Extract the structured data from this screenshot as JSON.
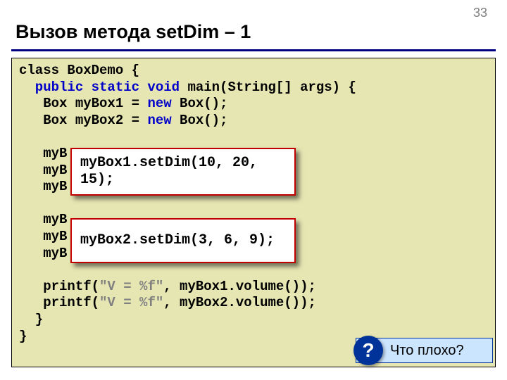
{
  "page_number": "33",
  "title": "Вызов метода setDim – 1",
  "code": {
    "l1a": "class",
    "l1b": " BoxDemo {",
    "l2a": "  public static void",
    "l2b": " main(String[] args) {",
    "l3a": "   Box myBox1 = ",
    "l3b": "new",
    "l3c": " Box();",
    "l4a": "   Box myBox2 = ",
    "l4b": "new",
    "l4c": " Box();",
    "l5": "",
    "l6": "   myB",
    "l7": "   myB",
    "l8": "   myB",
    "l9": "",
    "l10": "   myB",
    "l11": "   myB",
    "l12": "   myB",
    "l13": "",
    "l14a": "   printf(",
    "l14b": "\"V = %f\"",
    "l14c": ", myBox1.volume());",
    "l15a": "   printf(",
    "l15b": "\"V = %f\"",
    "l15c": ", myBox2.volume());",
    "l16": "  }",
    "l17": "}"
  },
  "callout1": "myBox1.setDim(10, 20, 15);",
  "callout2": "myBox2.setDim(3, 6, 9);",
  "question": {
    "icon": "?",
    "text": "Что плохо?"
  }
}
